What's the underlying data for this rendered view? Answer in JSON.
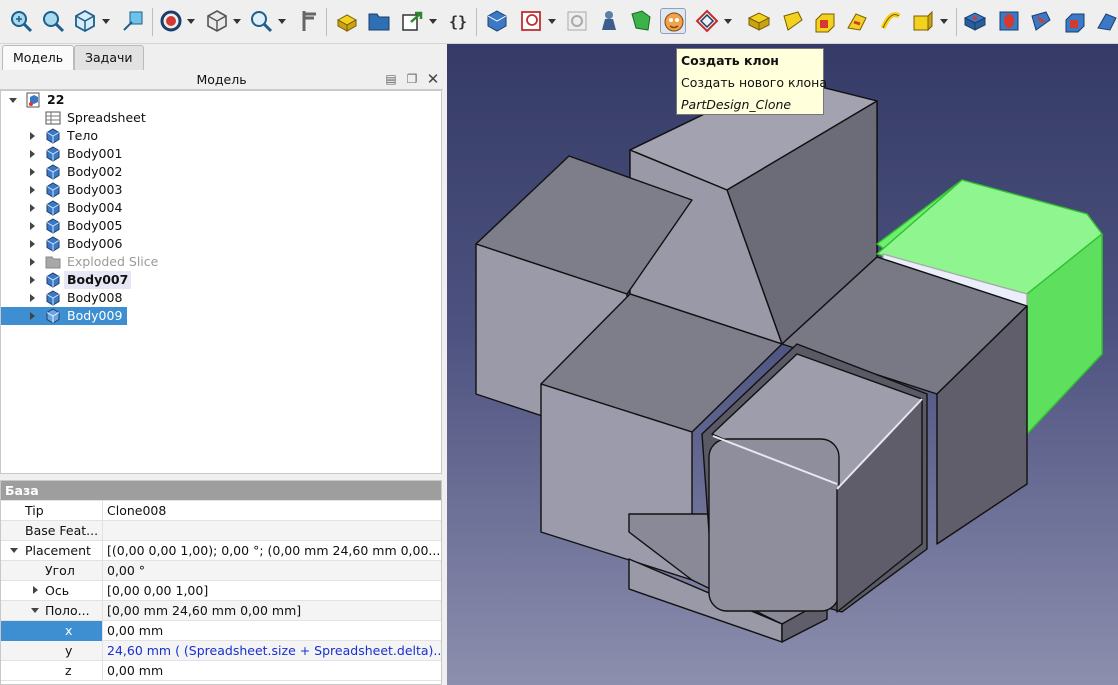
{
  "tabs": [
    {
      "label": "Модель"
    },
    {
      "label": "Задачи"
    }
  ],
  "model_panel": {
    "title": "Модель"
  },
  "tree": {
    "root": "22",
    "items": [
      {
        "label": "Spreadsheet",
        "icon": "spreadsheet-icon"
      },
      {
        "label": "Тело",
        "icon": "body-icon"
      },
      {
        "label": "Body001",
        "icon": "body-icon"
      },
      {
        "label": "Body002",
        "icon": "body-icon"
      },
      {
        "label": "Body003",
        "icon": "body-icon"
      },
      {
        "label": "Body004",
        "icon": "body-icon"
      },
      {
        "label": "Body005",
        "icon": "body-icon"
      },
      {
        "label": "Body006",
        "icon": "body-icon"
      },
      {
        "label": "Exploded Slice",
        "icon": "folder-icon"
      },
      {
        "label": "Body007",
        "icon": "body-icon"
      },
      {
        "label": "Body008",
        "icon": "body-icon"
      },
      {
        "label": "Body009",
        "icon": "body-icon"
      }
    ]
  },
  "properties": {
    "group": "База",
    "rows": [
      {
        "name": "Tip",
        "value": "Clone008"
      },
      {
        "name": "Base Feat...",
        "value": ""
      },
      {
        "name": "Placement",
        "value": "[(0,00 0,00 1,00); 0,00 °; (0,00 mm  24,60 mm  0,00..."
      },
      {
        "name": "Угол",
        "value": "0,00 °"
      },
      {
        "name": "Ось",
        "value": "[0,00 0,00 1,00]"
      },
      {
        "name": "Поло...",
        "value": "[0,00 mm  24,60 mm  0,00 mm]"
      },
      {
        "name": "x",
        "value": "0,00 mm"
      },
      {
        "name": "y",
        "value": "24,60 mm  ( (Spreadsheet.size + Spreadsheet.delta)..."
      },
      {
        "name": "z",
        "value": "0,00 mm"
      }
    ]
  },
  "tooltip": {
    "title": "Создать клон",
    "description": "Создать нового клона",
    "command": "PartDesign_Clone"
  },
  "colors": {
    "selection": "#3d8fd1",
    "highlight_body": "#6ef06e",
    "viewport_top": "#353b66",
    "viewport_bottom": "#8d8fae"
  }
}
